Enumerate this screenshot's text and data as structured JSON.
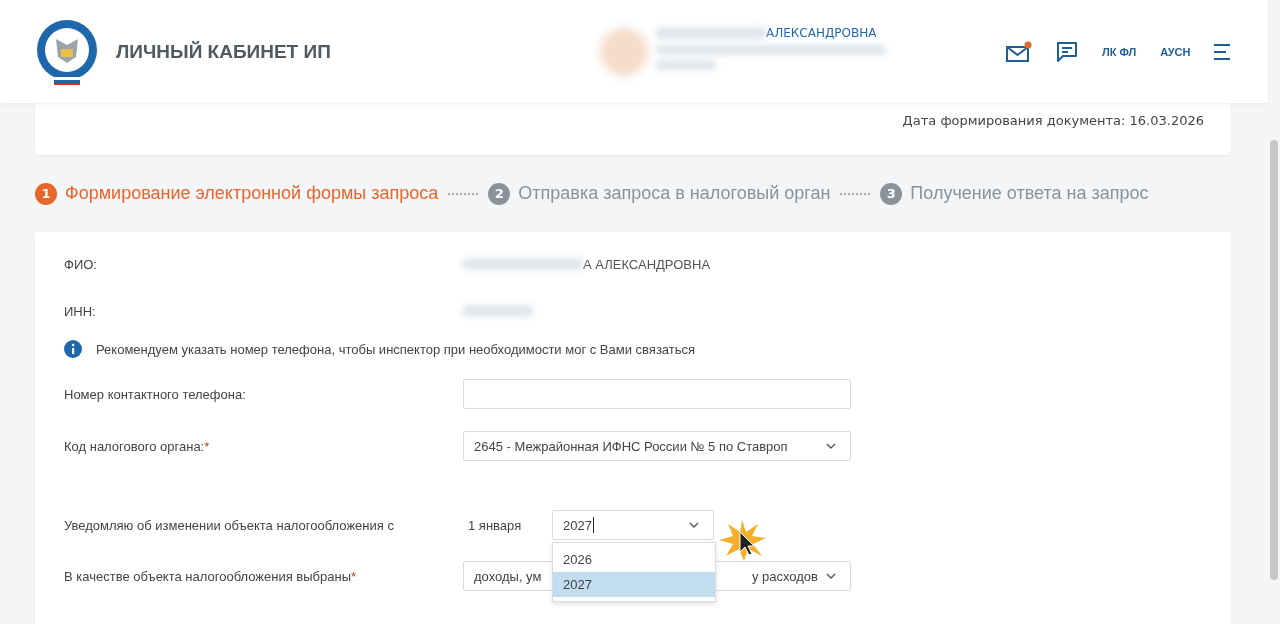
{
  "header": {
    "title": "ЛИЧНЫЙ КАБИНЕТ ИП",
    "user_name_visible": "АЛЕКСАНДРОВНА",
    "mail_notification": true,
    "links": [
      "ЛК ФЛ",
      "АУСН"
    ]
  },
  "document_info": {
    "date_text": "Дата формирования документа: 16.03.2026"
  },
  "steps": [
    {
      "number": "1",
      "label": "Формирование электронной формы запроса",
      "active": true
    },
    {
      "number": "2",
      "label": "Отправка запроса в налоговый орган",
      "active": false
    },
    {
      "number": "3",
      "label": "Получение ответа на запрос",
      "active": false
    }
  ],
  "form": {
    "fio": {
      "label": "ФИО:",
      "value_visible": "А АЛЕКСАНДРОВНА"
    },
    "inn": {
      "label": "ИНН:"
    },
    "info": "Рекомендуем указать номер телефона, чтобы инспектор при необходимости мог с Вами связаться",
    "phone": {
      "label": "Номер контактного телефона:"
    },
    "tax_office": {
      "label": "Код налогового органа:",
      "required_mark": "*",
      "value": "2645 - Межрайонная ИФНС России № 5 по Ставроп"
    },
    "change_date": {
      "label": "Уведомляю об изменении объекта налогообложения с",
      "prefix": "1 января",
      "value": "2027",
      "expanded": true,
      "options": [
        {
          "label": "2026",
          "selected": false
        },
        {
          "label": "2027",
          "selected": true
        }
      ]
    },
    "tax_object": {
      "label": "В качестве объекта налогообложения выбраны",
      "required_mark": "*",
      "value_start": "доходы, ум",
      "value_end": "у расходов"
    }
  }
}
